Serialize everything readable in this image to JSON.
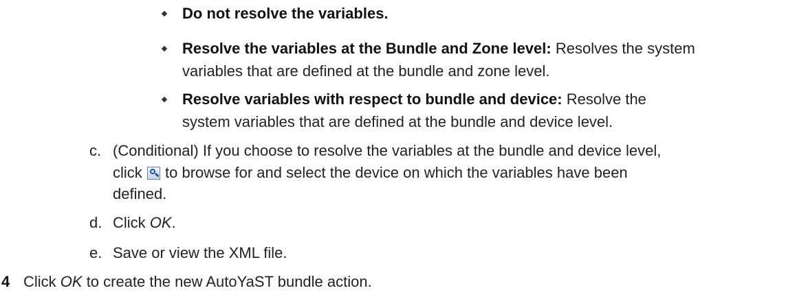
{
  "bullets": [
    {
      "bold": "Do not resolve the variables.",
      "text": ""
    },
    {
      "bold": "Resolve the variables at the Bundle and Zone level:",
      "text": " Resolves the system",
      "cont": "variables that are defined at the bundle and zone level."
    },
    {
      "bold": "Resolve variables with respect to bundle and device:",
      "text": " Resolve the",
      "cont": "system variables that are defined at the bundle and device level."
    }
  ],
  "substeps": {
    "c": {
      "marker": "c.",
      "line1": "(Conditional) If you choose to resolve the variables at the bundle and device level,",
      "line2_before": "click",
      "line2_after": "to browse for and select the device on which the variables have been",
      "line3": "defined.",
      "icon": "search-icon"
    },
    "d": {
      "marker": "d.",
      "before": "Click ",
      "em": "OK",
      "after": "."
    },
    "e": {
      "marker": "e.",
      "text": "Save or view the XML file."
    }
  },
  "step4": {
    "number": "4",
    "before": "Click ",
    "em": "OK",
    "after": " to create the new AutoYaST bundle action."
  }
}
